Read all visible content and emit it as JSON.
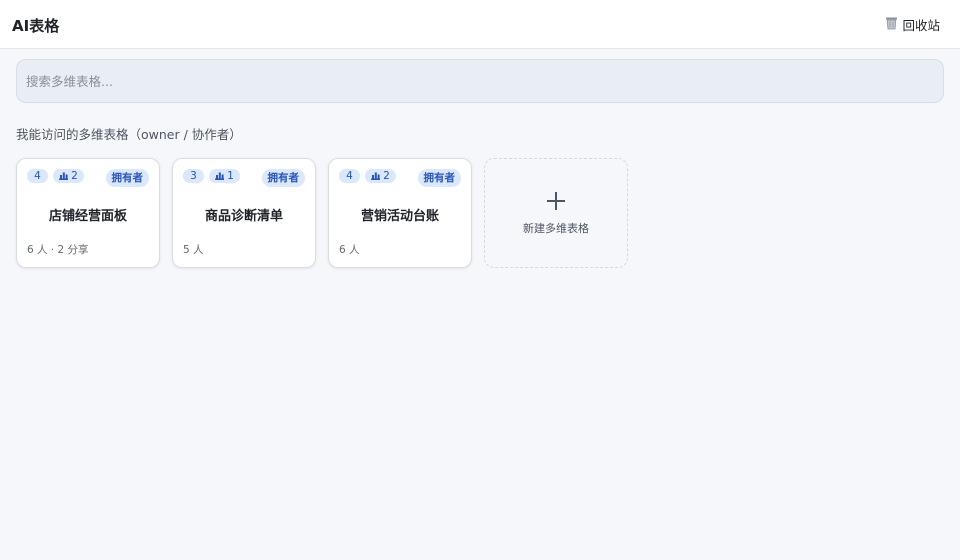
{
  "header": {
    "title": "AI表格",
    "trash_label": "回收站"
  },
  "search": {
    "placeholder": "搜索多维表格..."
  },
  "section": {
    "label": "我能访问的多维表格（owner / 协作者）"
  },
  "cards": [
    {
      "count": "4",
      "tables": "2",
      "role": "拥有者",
      "title": "店铺经营面板",
      "meta": "6 人 · 2 分享"
    },
    {
      "count": "3",
      "tables": "1",
      "role": "拥有者",
      "title": "商品诊断清单",
      "meta": "5 人"
    },
    {
      "count": "4",
      "tables": "2",
      "role": "拥有者",
      "title": "营销活动台账",
      "meta": "6 人"
    }
  ],
  "new_card": {
    "label": "新建多维表格"
  },
  "colors": {
    "accent": "#2a55b8",
    "badge_bg": "#dbe7fb",
    "page_bg": "#f6f7fb"
  }
}
